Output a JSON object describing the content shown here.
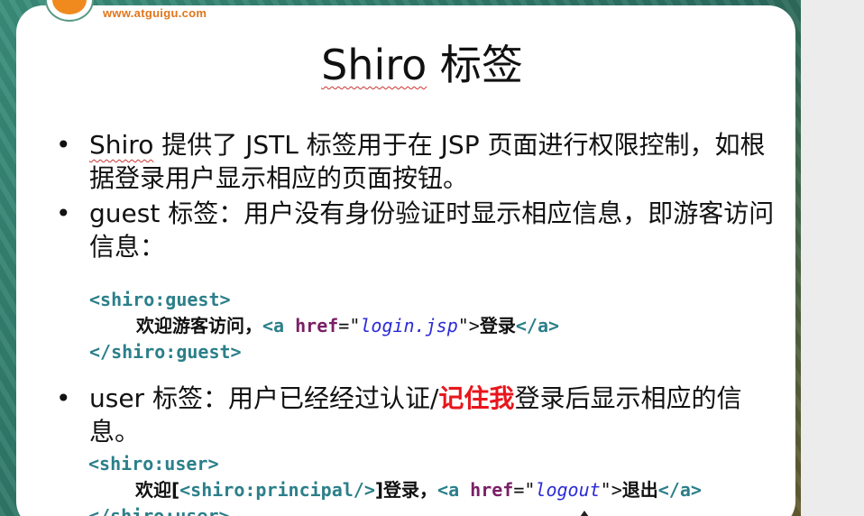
{
  "logo": {
    "url": "www.atguigu.com"
  },
  "title": {
    "brand": "Shiro",
    "rest": " 标签"
  },
  "bullets": [
    {
      "brand": "Shiro",
      "text": " 提供了 JSTL 标签用于在 JSP 页面进行权限控制，如根据登录用户显示相应的页面按钮。"
    },
    {
      "text": "guest 标签：用户没有身份验证时显示相应信息，即游客访问信息："
    },
    {
      "pre": "user 标签：用户已经经过认证/",
      "highlight": "记住我",
      "post": "登录后显示相应的信息。"
    }
  ],
  "code_guest": {
    "open": "<shiro:guest>",
    "text": "欢迎游客访问，",
    "a_open": "<a ",
    "attr": "href",
    "eq": "=\"",
    "href": "login.jsp",
    "quote_close": "\">",
    "link_text": "登录",
    "a_close": "</a>",
    "close": "</shiro:guest>"
  },
  "code_user": {
    "open": "<shiro:user>",
    "text1": "欢迎[",
    "principal": "<shiro:principal/>",
    "text2": "]登录，",
    "a_open": "<a ",
    "attr": "href",
    "eq": "=\"",
    "href": "logout",
    "quote_close": "\">",
    "link_text": "退出",
    "a_close": "</a>",
    "close": "</shiro:user>"
  },
  "colors": {
    "tag": "#2b7f8a",
    "attr": "#7a1f66",
    "string": "#2a2ad6",
    "highlight": "#e8161c",
    "logo": "#f08a1e"
  },
  "icons": {
    "bullet": "•",
    "logo": "atguigu-logo-icon",
    "cursor": "mouse-pointer-icon"
  }
}
